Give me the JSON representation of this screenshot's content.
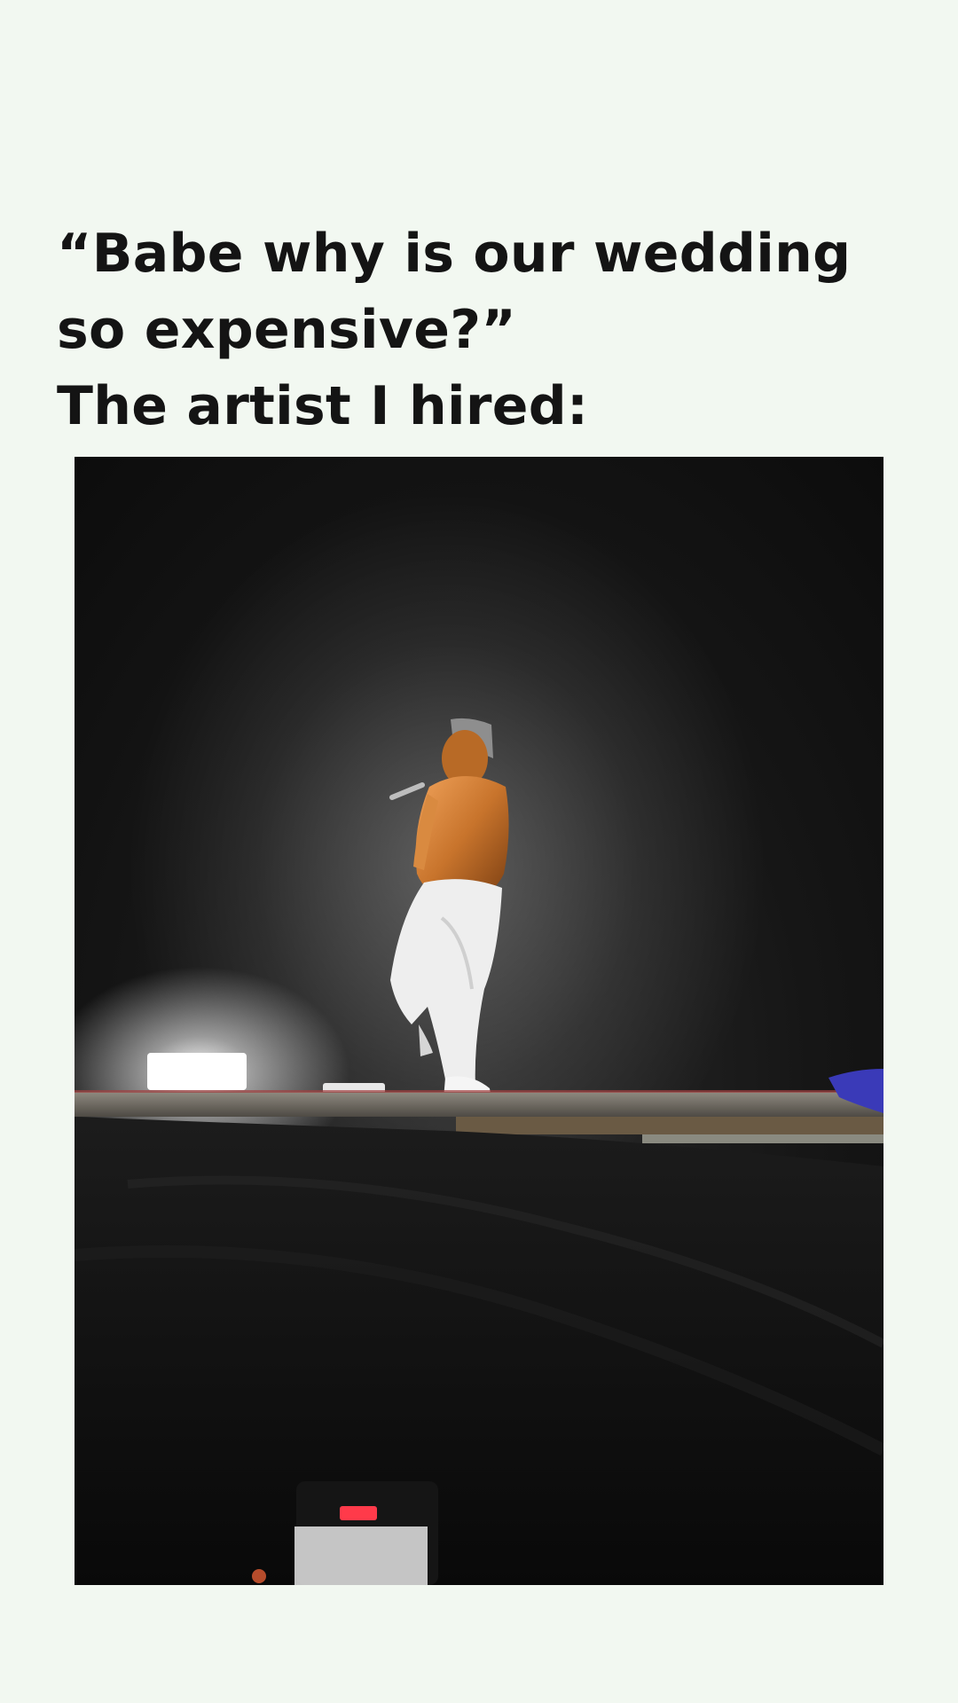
{
  "caption": {
    "line1": "“Babe why is our wedding",
    "line2": "so expensive?”",
    "line3": "The artist I hired:"
  },
  "colors": {
    "page_background": "#f2f8f1",
    "caption_text": "#141414",
    "photo_sky": "#131313",
    "stage_cloth": "#0f0f0f",
    "stage_light": "#ffffff",
    "skin_glow": "#c8742c",
    "pants": "#eeeeee",
    "tally_light": "#ff3a4a"
  },
  "photo": {
    "subject": "performer-on-stage"
  }
}
